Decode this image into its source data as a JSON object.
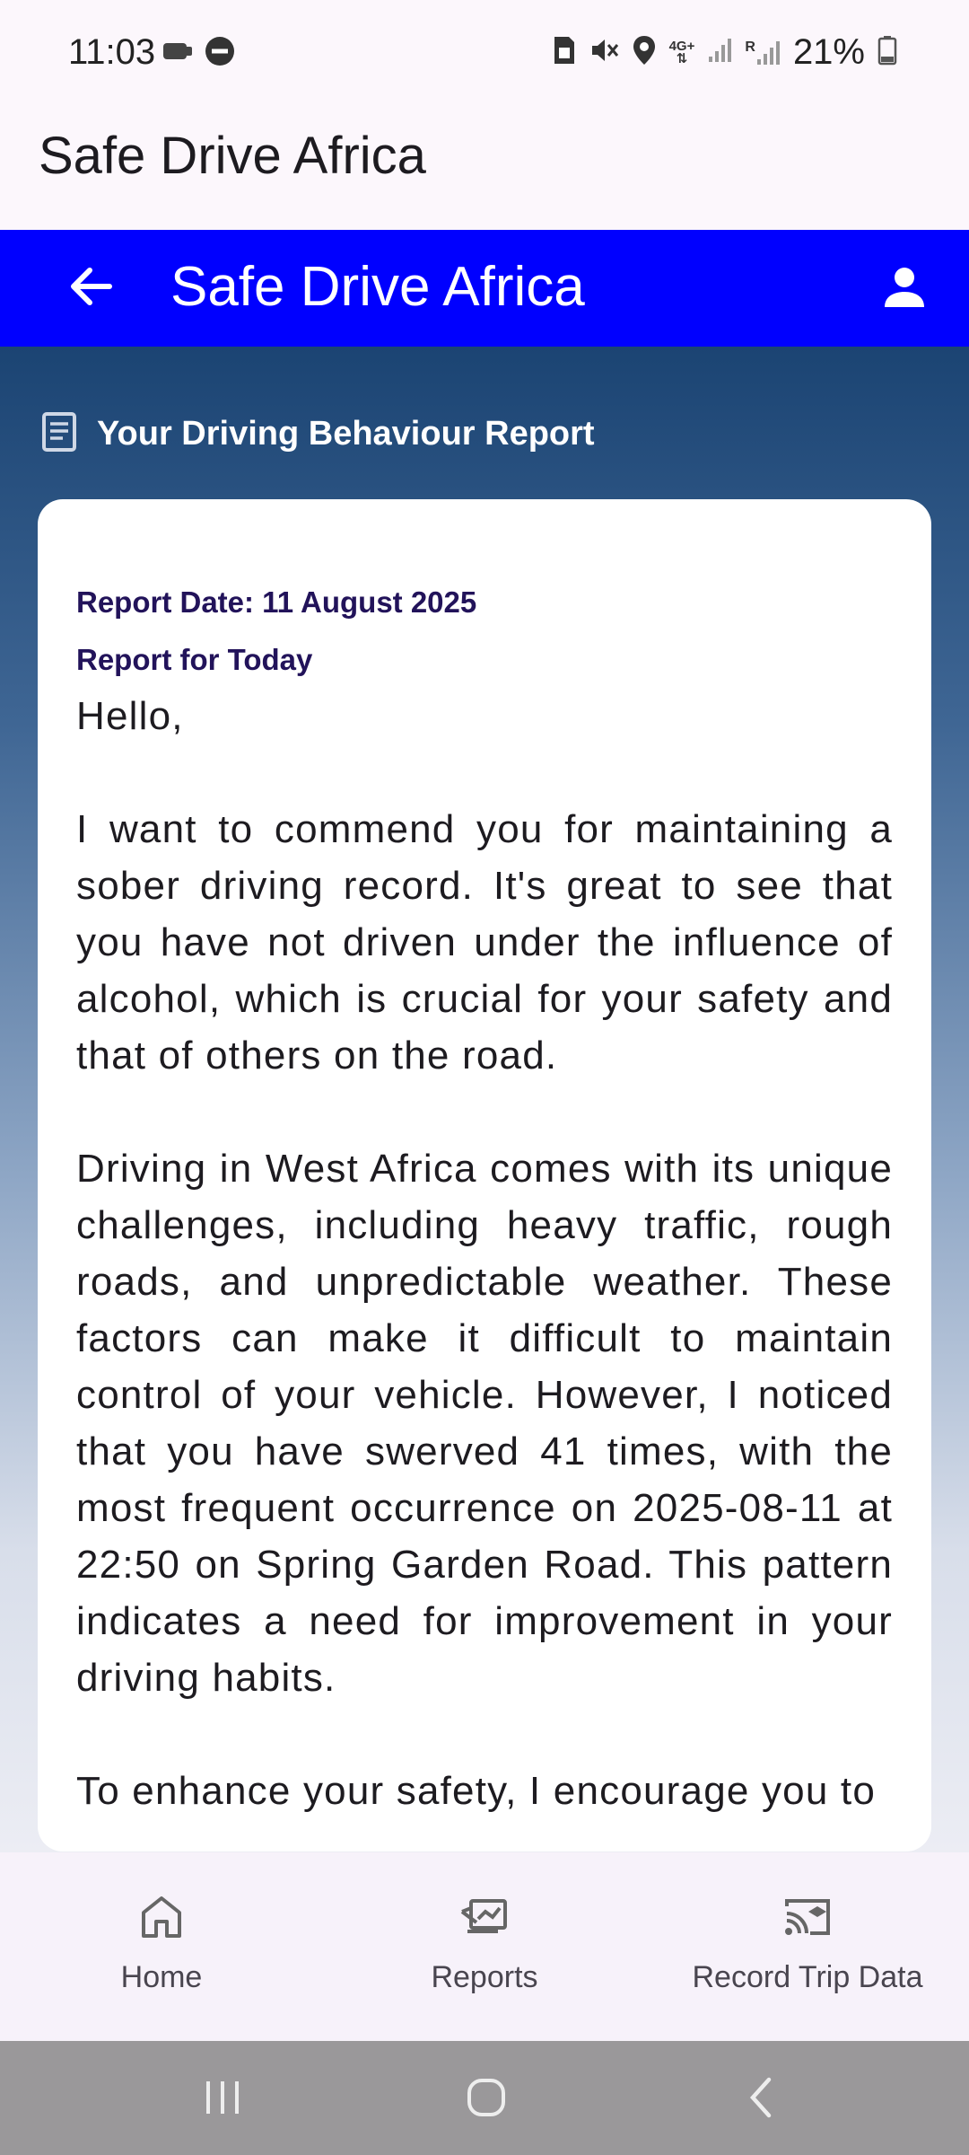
{
  "status_bar": {
    "time": "11:03",
    "battery_text": "21%",
    "left_icons": [
      "silent-mode-icon",
      "do-not-disturb-icon"
    ],
    "right_icons": [
      "sim-icon",
      "mute-icon",
      "location-icon",
      "network-4g-icon",
      "signal-icon",
      "roaming-signal-icon",
      "battery-icon"
    ],
    "network_label": "4G+",
    "roaming_label": "R"
  },
  "app": {
    "title": "Safe Drive Africa"
  },
  "top_bar": {
    "title": "Safe Drive Africa",
    "back_icon": "arrow-back-icon",
    "profile_icon": "person-icon",
    "background": "#0000ff"
  },
  "report": {
    "section_icon": "document-icon",
    "section_title": "Your Driving Behaviour Report",
    "date_line": "Report Date: 11 August 2025",
    "period_line": "Report for Today",
    "greeting": "Hello,",
    "paragraph_1": "I want to commend you for maintaining a sober driving record. It's great to see that you have not driven under the influence of alcohol, which is crucial for your safety and that of others on the road.",
    "paragraph_2": "Driving in West Africa comes with its unique challenges, including heavy traffic, rough roads, and unpredictable weather. These factors can make it difficult to maintain control of your vehicle. However, I noticed that you have swerved 41 times, with the most frequent occurrence on 2025-08-11 at 22:50 on Spring Garden Road. This pattern indicates a need for improvement in your driving habits.",
    "paragraph_3": "To enhance your safety, I encourage you to"
  },
  "bottom_nav": {
    "items": [
      {
        "label": "Home",
        "icon": "home-icon"
      },
      {
        "label": "Reports",
        "icon": "report-icon"
      },
      {
        "label": "Record Trip Data",
        "icon": "cast-record-icon"
      }
    ]
  },
  "system_nav": {
    "icons": [
      "recents-icon",
      "home-circle-icon",
      "back-chevron-icon"
    ]
  }
}
